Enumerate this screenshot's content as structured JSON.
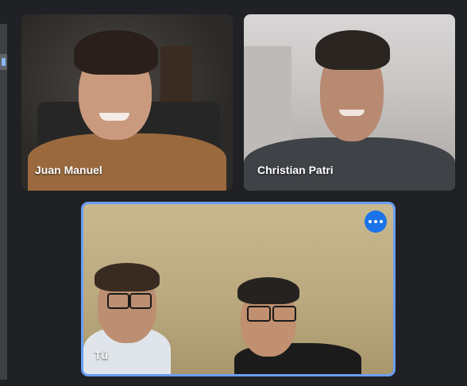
{
  "participants": [
    {
      "name": "Juan Manuel"
    },
    {
      "name": "Christian Patri"
    }
  ],
  "self_view": {
    "label": "Tú",
    "menu_icon": "more-horizontal-icon"
  },
  "colors": {
    "background": "#202124",
    "active_border": "#6a9ef6",
    "menu_button": "#1a73e8"
  }
}
